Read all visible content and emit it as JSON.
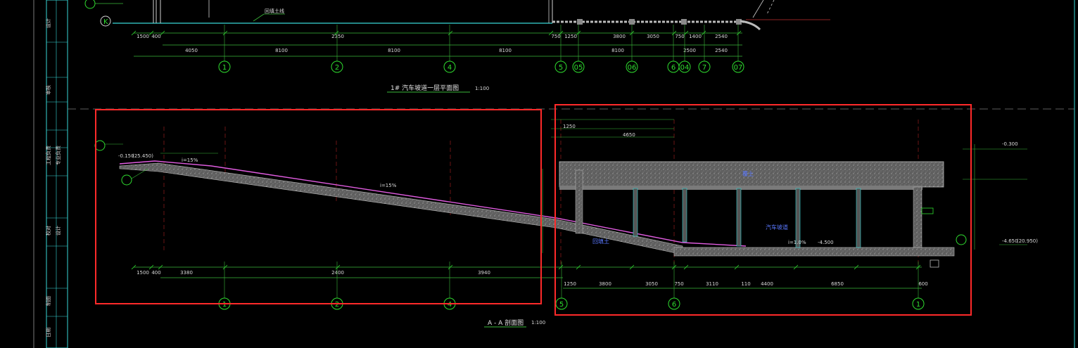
{
  "top_plan": {
    "title": "1# 汽车坡道一层平面图",
    "scale": "1:100",
    "axis_k": "K",
    "note_label": "回填土线",
    "top_dims": [
      "1500",
      "400",
      "2350",
      "750",
      "1250",
      "3800",
      "3050",
      "750",
      "1400",
      "2540"
    ],
    "bottom_dims": [
      "4050",
      "8100",
      "8100",
      "8100",
      "8100",
      "2500",
      "2540"
    ],
    "axes": [
      "1",
      "2",
      "4",
      "5",
      "05",
      "06",
      "6",
      "04",
      "7",
      "07"
    ]
  },
  "section": {
    "title": "A - A 剖面图",
    "scale": "1:100",
    "label_backfill": "回填土",
    "label_ramp": "汽车坡道",
    "label_soil": "覆土",
    "label_slope_1": "i=15%",
    "label_slope_2": "i=15%",
    "label_slope_3": "i=1.0%",
    "left_elev_1": "-0.150",
    "left_elev_2": "(25.450)",
    "right_elev_1": "-0.300",
    "right_elev_2": "-4.650",
    "right_elev_3": "(20.950)",
    "mid_elev": "-4.500",
    "bottom_dims_left": [
      "1500",
      "400",
      "3380",
      "2400",
      "3940"
    ],
    "bottom_dims_right": [
      "1250",
      "3800",
      "3050",
      "750",
      "3110",
      "110",
      "4400",
      "6850",
      "600"
    ],
    "bottom_axes": [
      "1",
      "2",
      "4",
      "5",
      "6",
      "1"
    ],
    "top_dims_right": [
      "1250",
      "4650"
    ]
  },
  "side_panel": {
    "rows": [
      "设计",
      "审核",
      "工程负责",
      "专业负责",
      "校对",
      "设计",
      "制图",
      "日期"
    ]
  },
  "highlight_boxes": [
    "left-section-highlight",
    "right-section-highlight"
  ],
  "colors": {
    "background": "#000000",
    "grid_line": "#2fdc2f",
    "dim_line": "#3ab83a",
    "magenta_line": "#e05ce0",
    "highlight_red": "#ff2a2a",
    "section_fill": "#8a8a8a",
    "cyan": "#38d6d6"
  }
}
